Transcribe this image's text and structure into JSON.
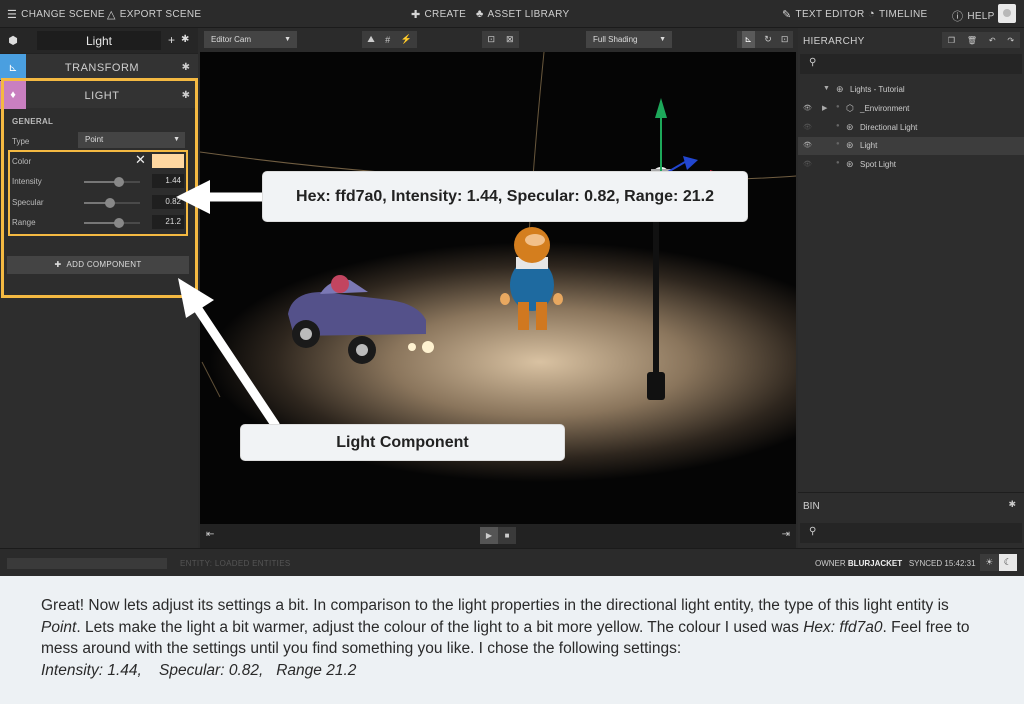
{
  "topbar": {
    "change_scene": "CHANGE SCENE",
    "export_scene": "EXPORT SCENE",
    "create": "CREATE",
    "asset_library": "ASSET LIBRARY",
    "text_editor": "TEXT EDITOR",
    "timeline": "TIMELINE",
    "help": "HELP"
  },
  "entity": {
    "name": "Light"
  },
  "components": {
    "transform": {
      "title": "TRANSFORM"
    },
    "light": {
      "title": "LIGHT",
      "section": "GENERAL",
      "type_label": "Type",
      "type_value": "Point",
      "color_label": "Color",
      "color_hex": "#ffd7a0",
      "intensity_label": "Intensity",
      "intensity_value": "1.44",
      "intensity_level": 0.62,
      "specular_label": "Specular",
      "specular_value": "0.82",
      "specular_level": 0.47,
      "range_label": "Range",
      "range_value": "21.2",
      "range_level": 0.62
    },
    "add_component": "ADD COMPONENT"
  },
  "viewport": {
    "camera": "Editor Cam",
    "shading": "Full Shading"
  },
  "hierarchy": {
    "title": "HIERARCHY",
    "items": [
      {
        "label": "Lights - Tutorial",
        "indent": 0
      },
      {
        "label": "_Environment",
        "indent": 1
      },
      {
        "label": "Directional Light",
        "indent": 1
      },
      {
        "label": "Light",
        "indent": 1
      },
      {
        "label": "Spot Light",
        "indent": 1
      }
    ]
  },
  "bin": {
    "title": "BIN"
  },
  "statusbar": {
    "status": "ENTITY: LOADED ENTITIES",
    "owner_label": "OWNER",
    "owner": "BLURJACKET",
    "synced": "SYNCED 15:42:31"
  },
  "callouts": {
    "settings": "Hex: ffd7a0, Intensity: 1.44, Specular: 0.82, Range: 21.2",
    "component": "Light Component"
  },
  "caption": {
    "p1": "Great! Now lets adjust its settings a bit. In comparison to the light properties in the directional light entity, the type of this light entity is ",
    "p1_em": "Point",
    "p2": ". Lets make the light a bit warmer, adjust the colour of the light to a bit more yellow. The colour I used was ",
    "p2_em": "Hex: ffd7a0",
    "p3": ". Feel free to mess around with the settings until you find something you like. I chose the following settings:",
    "p3_em": "Intensity: 1.44,    Specular: 0.82,   Range 21.2"
  },
  "colors": {
    "accent_highlight": "#f4b942",
    "transform_badge": "#4a9fe0",
    "light_badge": "#c97fc0"
  }
}
